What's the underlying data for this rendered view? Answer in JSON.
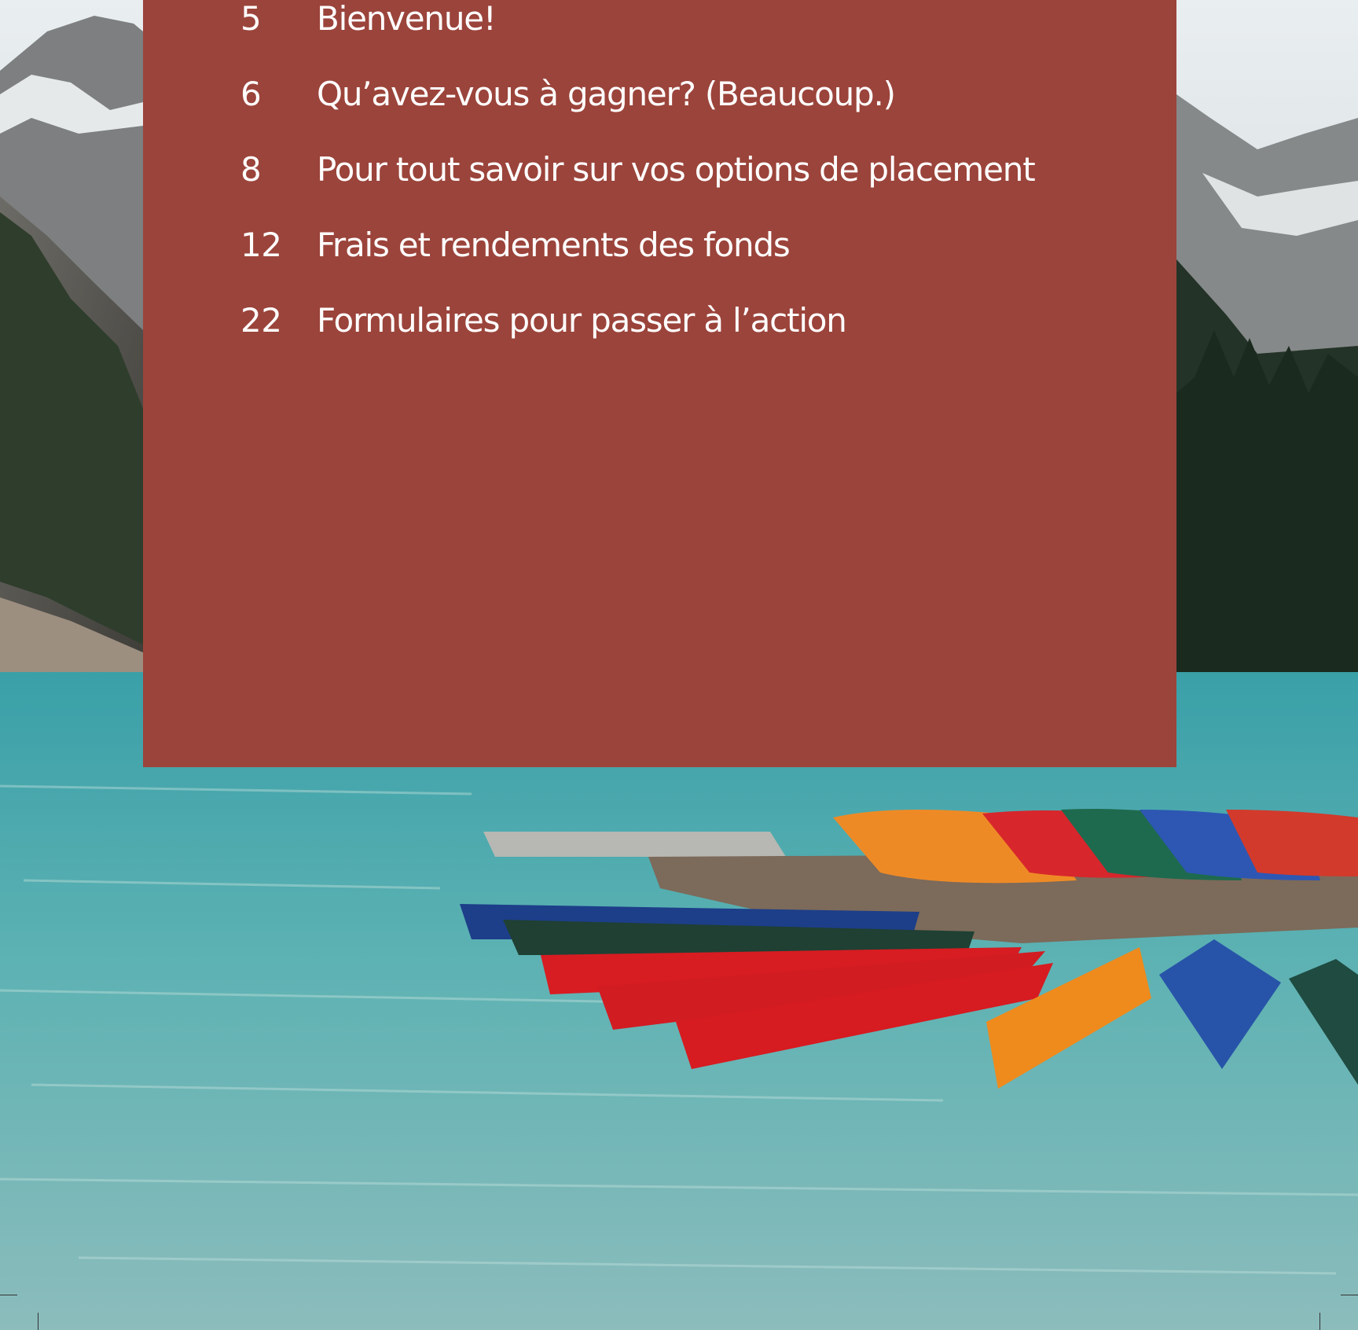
{
  "toc": {
    "items": [
      {
        "page": "5",
        "title": "Bienvenue!"
      },
      {
        "page": "6",
        "title": "Qu’avez-vous à gagner? (Beaucoup.)"
      },
      {
        "page": "8",
        "title": "Pour tout savoir sur vos options de placement"
      },
      {
        "page": "12",
        "title": "Frais et rendements des fonds"
      },
      {
        "page": "22",
        "title": "Formulaires pour passer à l’action"
      }
    ]
  },
  "colors": {
    "panel": "#9b443b",
    "text": "#ffffff",
    "water": "#3f9ea3"
  }
}
